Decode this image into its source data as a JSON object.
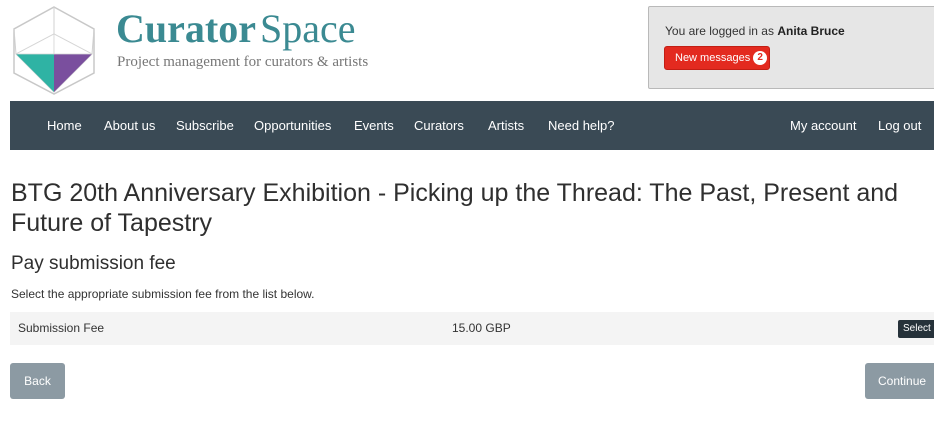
{
  "brand": {
    "name_bold": "Curator",
    "name_light": "Space",
    "tagline": "Project management for curators & artists",
    "colors": {
      "teal": "#3b8a92",
      "purple": "#7a4f9e",
      "nav": "#3a4a55"
    }
  },
  "login": {
    "prefix": "You are logged in as",
    "user": "Anita Bruce",
    "messages_label": "New messages",
    "messages_count": "2"
  },
  "nav": {
    "home": "Home",
    "about": "About us",
    "subscribe": "Subscribe",
    "opportunities": "Opportunities",
    "events": "Events",
    "curators": "Curators",
    "artists": "Artists",
    "help": "Need help?",
    "account": "My account",
    "logout": "Log out"
  },
  "page": {
    "title": "BTG 20th Anniversary Exhibition - Picking up the Thread: The Past, Present and Future of Tapestry",
    "section": "Pay submission fee",
    "instructions": "Select the appropriate submission fee from the list below."
  },
  "fee": {
    "name": "Submission Fee",
    "amount": "15.00 GBP",
    "select_label": "Select"
  },
  "actions": {
    "back": "Back",
    "continue": "Continue"
  }
}
